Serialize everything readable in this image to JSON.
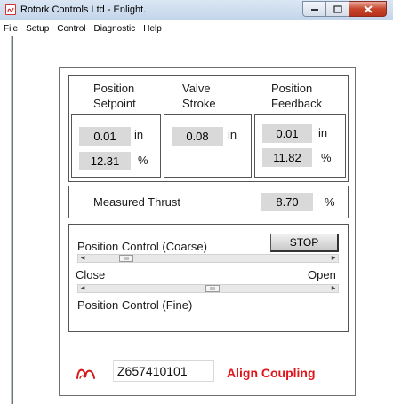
{
  "window": {
    "title": "Rotork Controls Ltd - Enlight."
  },
  "menu": [
    "File",
    "Setup",
    "Control",
    "Diagnostic",
    "Help"
  ],
  "position_setpoint": {
    "label_line1": "Position",
    "label_line2": "Setpoint",
    "value_in": "0.01",
    "unit_in": "in",
    "value_pct": "12.31",
    "unit_pct": "%"
  },
  "valve_stroke": {
    "label_line1": "Valve",
    "label_line2": "Stroke",
    "value_in": "0.08",
    "unit_in": "in"
  },
  "position_feedback": {
    "label_line1": "Position",
    "label_line2": "Feedback",
    "value_in": "0.01",
    "unit_in": "in",
    "value_pct": "11.82",
    "unit_pct": "%"
  },
  "measured_thrust": {
    "label": "Measured Thrust",
    "value": "8.70",
    "unit": "%"
  },
  "control": {
    "coarse_label": "Position Control (Coarse)",
    "stop_label": "STOP",
    "close_label": "Close",
    "open_label": "Open",
    "fine_label": "Position Control (Fine)",
    "coarse_slider_fraction": 0.14,
    "fine_slider_fraction": 0.52
  },
  "footer": {
    "serial": "Z657410101",
    "status": "Align Coupling",
    "status_color": "#e0141b",
    "logo_icon": "rotork-logo-icon"
  }
}
